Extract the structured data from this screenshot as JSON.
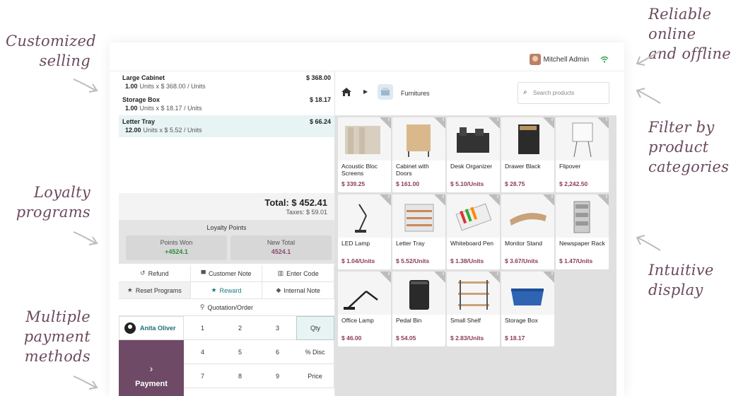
{
  "captions": {
    "customized_selling": [
      "Customized",
      "selling"
    ],
    "loyalty_programs": [
      "Loyalty",
      "programs"
    ],
    "multiple_payment": [
      "Multiple",
      "payment",
      "methods"
    ],
    "reliable": [
      "Reliable online",
      "and offline"
    ],
    "filter": [
      "Filter by",
      "product",
      "categories"
    ],
    "intuitive": [
      "Intuitive",
      "display"
    ]
  },
  "topbar": {
    "user_name": "Mitchell Admin",
    "status_icon": "wifi-icon"
  },
  "order": {
    "lines": [
      {
        "name": "Large Cabinet",
        "price": "$ 368.00",
        "qty": "1.00",
        "detail": "Units x $ 368.00 / Units",
        "selected": false
      },
      {
        "name": "Storage Box",
        "price": "$ 18.17",
        "qty": "1.00",
        "detail": "Units x $ 18.17 / Units",
        "selected": false
      },
      {
        "name": "Letter Tray",
        "price": "$ 66.24",
        "qty": "12.00",
        "detail": "Units x $ 5.52 / Units",
        "selected": true
      }
    ],
    "total": "Total: $ 452.41",
    "taxes": "Taxes: $ 59.01"
  },
  "loyalty": {
    "title": "Loyalty Points",
    "points_won_label": "Points Won",
    "points_won_value": "+4524.1",
    "new_total_label": "New Total",
    "new_total_value": "4524.1"
  },
  "controls": {
    "refund": "Refund",
    "customer_note": "Customer Note",
    "enter_code": "Enter Code",
    "reset_programs": "Reset Programs",
    "reward": "Reward",
    "internal_note": "Internal Note",
    "quotation": "Quotation/Order"
  },
  "numpad": {
    "customer": "Anita Oliver",
    "payment": "Payment",
    "keys": [
      "1",
      "2",
      "3",
      "Qty",
      "4",
      "5",
      "6",
      "% Disc",
      "7",
      "8",
      "9",
      "Price"
    ]
  },
  "products_header": {
    "category": "Furnitures",
    "search_placeholder": "Search products"
  },
  "products": [
    {
      "name": "Acoustic Bloc Screens",
      "price": "$ 339.25"
    },
    {
      "name": "Cabinet with Doors",
      "price": "$ 161.00"
    },
    {
      "name": "Desk Organizer",
      "price": "$ 5.10/Units"
    },
    {
      "name": "Drawer Black",
      "price": "$ 28.75"
    },
    {
      "name": "Flipover",
      "price": "$ 2,242.50"
    },
    {
      "name": "LED Lamp",
      "price": "$ 1.04/Units"
    },
    {
      "name": "Letter Tray",
      "price": "$ 5.52/Units"
    },
    {
      "name": "Whiteboard Pen",
      "price": "$ 1.38/Units"
    },
    {
      "name": "Monitor Stand",
      "price": "$ 3.67/Units"
    },
    {
      "name": "Newspaper Rack",
      "price": "$ 1.47/Units"
    },
    {
      "name": "Office Lamp",
      "price": "$ 46.00"
    },
    {
      "name": "Pedal Bin",
      "price": "$ 54.05"
    },
    {
      "name": "Small Shelf",
      "price": "$ 2.83/Units"
    },
    {
      "name": "Storage Box",
      "price": "$ 18.17"
    }
  ],
  "colors": {
    "accent_purple": "#6e4a66",
    "price_color": "#8a3a57",
    "teal": "#1f7a80",
    "caption_color": "#6b4a5e"
  }
}
